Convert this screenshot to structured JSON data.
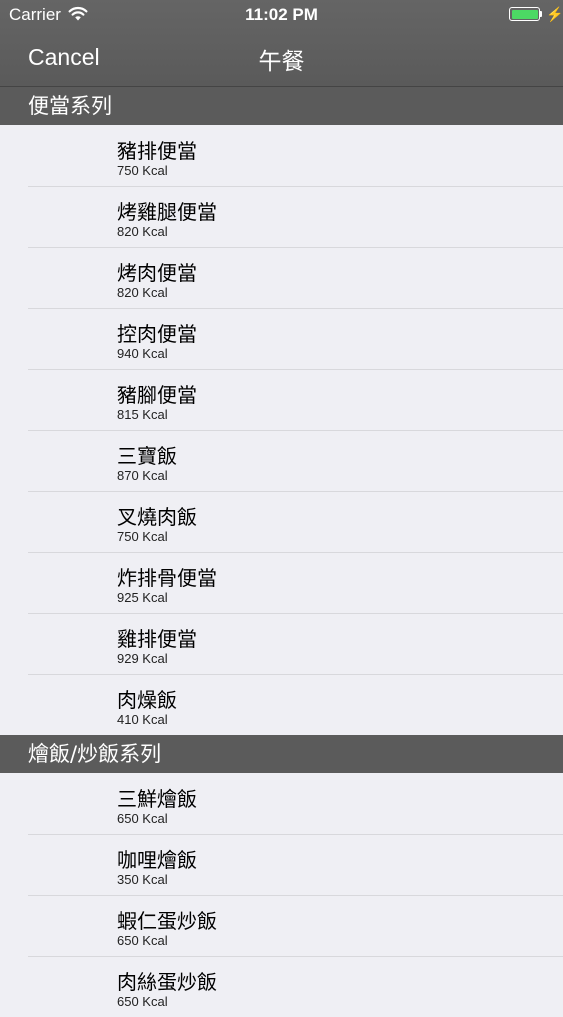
{
  "status_bar": {
    "carrier": "Carrier",
    "time": "11:02 PM",
    "battery_color": "#4cd964"
  },
  "nav": {
    "cancel_label": "Cancel",
    "title": "午餐"
  },
  "sections": [
    {
      "title": "便當系列",
      "items": [
        {
          "name": "豬排便當",
          "cal": "750  Kcal"
        },
        {
          "name": "烤雞腿便當",
          "cal": "820  Kcal"
        },
        {
          "name": "烤肉便當",
          "cal": "820  Kcal"
        },
        {
          "name": "控肉便當",
          "cal": "940  Kcal"
        },
        {
          "name": "豬腳便當",
          "cal": "815  Kcal"
        },
        {
          "name": "三寶飯",
          "cal": "870  Kcal"
        },
        {
          "name": "叉燒肉飯",
          "cal": "750  Kcal"
        },
        {
          "name": "炸排骨便當",
          "cal": "925  Kcal"
        },
        {
          "name": "雞排便當",
          "cal": "929  Kcal"
        },
        {
          "name": "肉燥飯",
          "cal": "410  Kcal"
        }
      ]
    },
    {
      "title": "燴飯/炒飯系列",
      "items": [
        {
          "name": "三鮮燴飯",
          "cal": "650  Kcal"
        },
        {
          "name": "咖哩燴飯",
          "cal": "350  Kcal"
        },
        {
          "name": "蝦仁蛋炒飯",
          "cal": "650  Kcal"
        },
        {
          "name": "肉絲蛋炒飯",
          "cal": "650  Kcal"
        }
      ]
    }
  ]
}
